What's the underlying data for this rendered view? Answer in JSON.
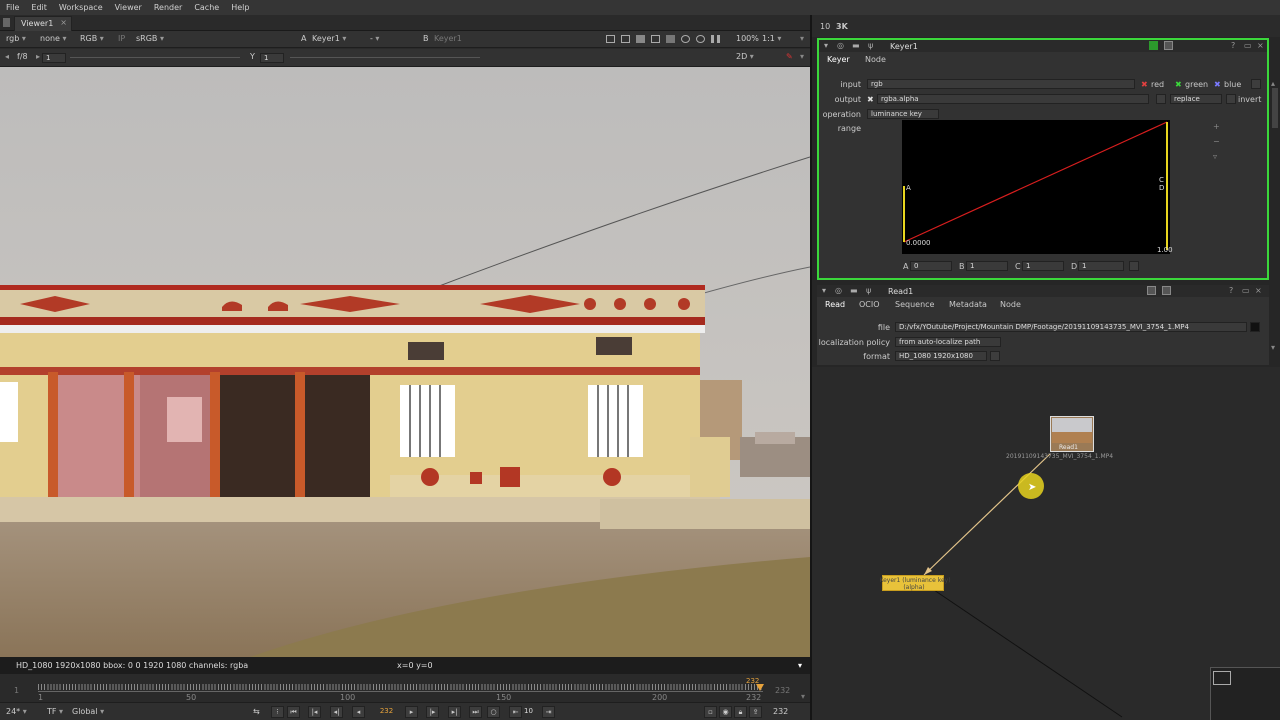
{
  "menu": [
    "File",
    "Edit",
    "Workspace",
    "Viewer",
    "Render",
    "Cache",
    "Help"
  ],
  "viewer_tab": "Viewer1",
  "viewer_toolbar": {
    "channels": "rgb",
    "alpha": "none",
    "display": "RGB",
    "ip": "IP",
    "lut": "sRGB",
    "input_a_label": "A",
    "input_a": "Keyer1",
    "wipe": "-",
    "input_b_label": "B",
    "input_b": "Keyer1",
    "zoom": "100%",
    "ratio": "1:1",
    "fstop": "f/8",
    "gain_value": "1",
    "gamma_label": "Y",
    "gamma_value": "1",
    "view_mode": "2D"
  },
  "info_bar": {
    "format": "HD_1080 1920x1080  bbox: 0 0 1920 1080 channels: rgba",
    "coords": "x=0 y=0"
  },
  "timeline": {
    "start": "1",
    "end": "232",
    "ticks": [
      "1",
      "50",
      "100",
      "150",
      "200",
      "232"
    ],
    "current": "232",
    "end_right": "232"
  },
  "playback": {
    "fps": "24*",
    "tf": "TF",
    "scope": "Global",
    "current_frame": "232",
    "increment": "10",
    "end_frame": "232"
  },
  "right_header": {
    "a": "10",
    "b": "3K"
  },
  "keyer": {
    "name": "Keyer1",
    "tabs": [
      "Keyer",
      "Node"
    ],
    "input_label": "input",
    "input_value": "rgb",
    "ch_red": "red",
    "ch_green": "green",
    "ch_blue": "blue",
    "output_label": "output",
    "output_value": "rgba.alpha",
    "merge": "replace",
    "invert": "invert",
    "operation_label": "operation",
    "operation_value": "luminance key",
    "range_label": "range",
    "curve_a": "A",
    "curve_cd": "C\nD",
    "curve_x0": "0.0000",
    "curve_x1": "1.00",
    "a_label": "A",
    "a_value": "0",
    "b_label": "B",
    "b_value": "1",
    "c_label": "C",
    "c_value": "1",
    "d_label": "D",
    "d_value": "1"
  },
  "read": {
    "name": "Read1",
    "tabs": [
      "Read",
      "OCIO",
      "Sequence",
      "Metadata",
      "Node"
    ],
    "file_label": "file",
    "file_value": "D:/vfx/YOutube/Project/Mountain DMP/Footage/20191109143735_MVI_3754_1.MP4",
    "policy_label": "localization policy",
    "policy_value": "from auto-localize path",
    "format_label": "format",
    "format_value": "HD_1080 1920x1080"
  },
  "nodes": {
    "read_node_label": "Read1",
    "read_node_file": "20191109143735_MVI_3754_1.MP4",
    "keyer_node_label": "Keyer1 (luminance key)",
    "keyer_node_sub": "(alpha)"
  },
  "colors": {
    "accent_green": "#3bd83b",
    "curve_red": "#d81e1e",
    "node_yellow": "#e8c23a",
    "cursor_yellow": "#e6d21e"
  }
}
